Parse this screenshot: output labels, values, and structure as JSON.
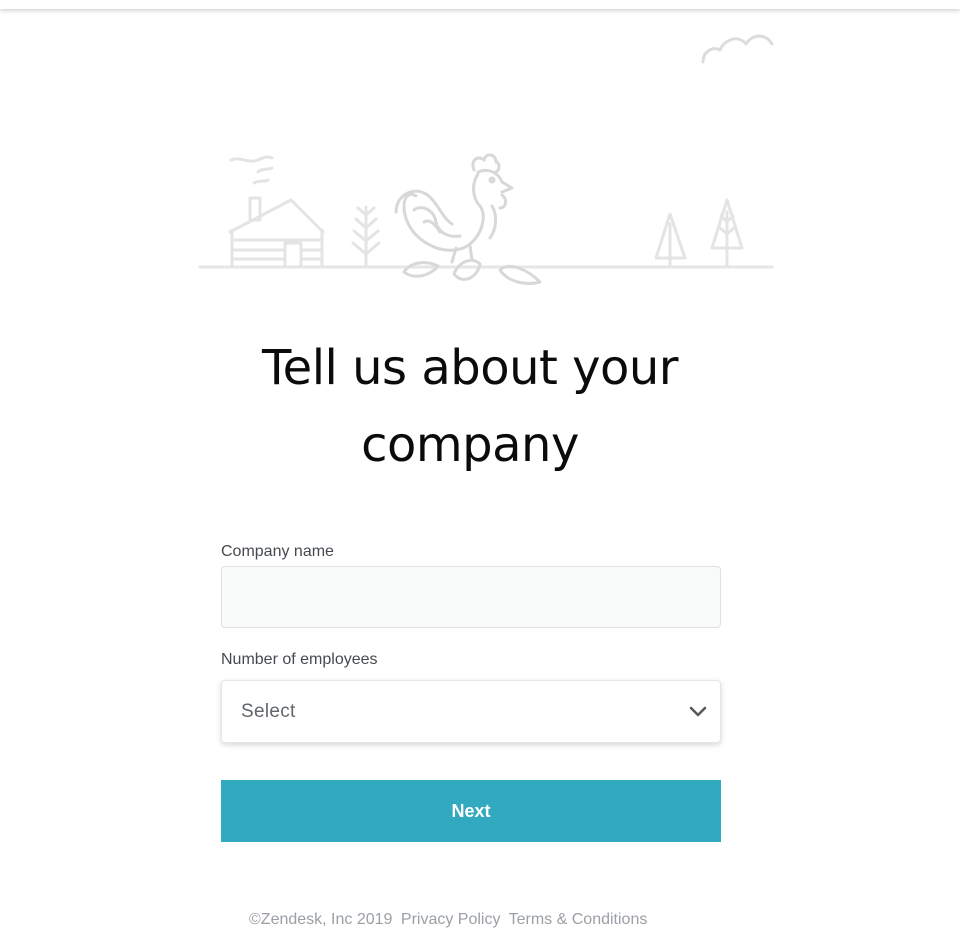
{
  "page": {
    "title_line1": "Tell us about your",
    "title_line2": "company"
  },
  "form": {
    "company_name_label": "Company name",
    "company_name_value": "",
    "employees_label": "Number of employees",
    "employees_selected": "Select",
    "next_label": "Next"
  },
  "footer": {
    "copyright": "©Zendesk, Inc 2019",
    "privacy": "Privacy Policy",
    "terms": "Terms & Conditions"
  },
  "colors": {
    "accent": "#31a9bf",
    "illustration_stroke": "#dedede"
  },
  "icons": [
    "cloud-icon",
    "cabin-icon",
    "tree-icon",
    "rooster-icon",
    "chevron-down-icon"
  ]
}
